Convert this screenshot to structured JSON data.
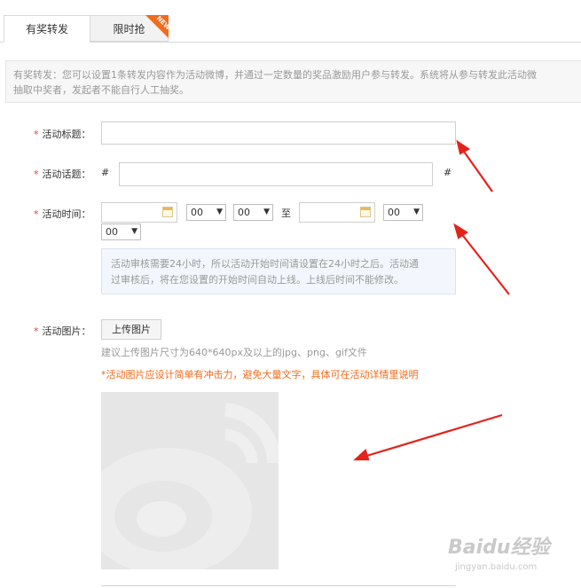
{
  "tabs": [
    {
      "label": "有奖转发"
    },
    {
      "label": "限时抢",
      "badge": "NEW"
    }
  ],
  "notice": {
    "line1": "有奖转发：您可以设置1条转发内容作为活动微博，并通过一定数量的奖品激励用户参与转发。系统将从参与转发此活动微",
    "line2": "抽取中奖者，发起者不能自行人工抽奖。"
  },
  "form": {
    "required_mark": "*",
    "title": {
      "label": "活动标题：",
      "value": ""
    },
    "topic": {
      "label": "活动话题：",
      "prefix": "#",
      "suffix": "#",
      "value": ""
    },
    "time": {
      "label": "活动时间：",
      "start_date": "",
      "start_hour": "00",
      "start_minute": "00",
      "separator": "至",
      "end_date": "",
      "end_hour": "00",
      "end_minute": "00",
      "tip_line1": "活动审核需要24小时，所以活动开始时间请设置在24小时之后。活动通",
      "tip_line2": "过审核后，将在您设置的开始时间自动上线。上线后时间不能修改。"
    },
    "image": {
      "label": "活动图片：",
      "upload_label": "上传图片",
      "hint": "建议上传图片尺寸为640*640px及以上的jpg、png、gif文件",
      "warning": "*活动图片应设计简单有冲击力，避免大量文字，具体可在活动详情里说明"
    }
  },
  "watermark": {
    "text": "Baidu经验",
    "sub": "jingyan.baidu.com"
  },
  "colors": {
    "required": "#e4393c",
    "warning": "#f26b1d",
    "arrow": "#e3231b",
    "badge": "#f26b1d"
  }
}
